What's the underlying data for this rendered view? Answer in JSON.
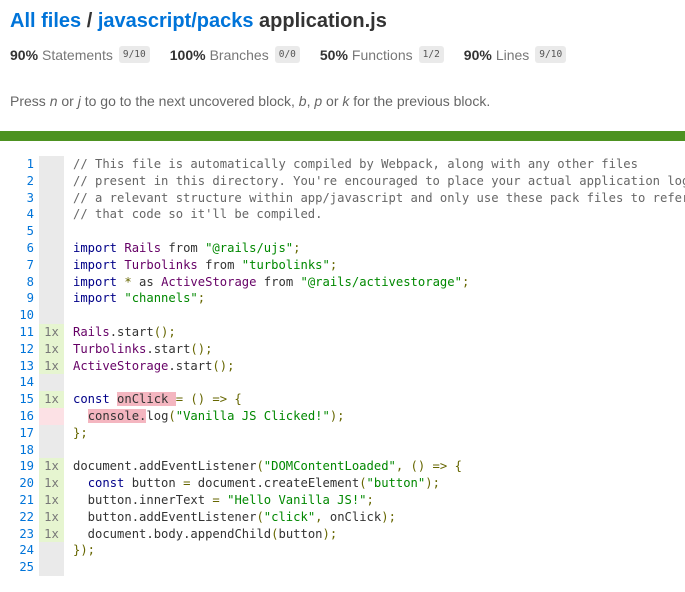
{
  "breadcrumb": {
    "all_files": "All files",
    "separator": " / ",
    "folder": "javascript/packs",
    "file": "application.js"
  },
  "stats": [
    {
      "pct": "90%",
      "label": "Statements",
      "frac": "9/10"
    },
    {
      "pct": "100%",
      "label": "Branches",
      "frac": "0/0"
    },
    {
      "pct": "50%",
      "label": "Functions",
      "frac": "1/2"
    },
    {
      "pct": "90%",
      "label": "Lines",
      "frac": "9/10"
    }
  ],
  "hint": {
    "t1": "Press ",
    "n": "n",
    "t2": " or ",
    "j": "j",
    "t3": " to go to the next uncovered block, ",
    "b": "b",
    "t4": ", ",
    "p": "p",
    "t5": " or ",
    "k": "k",
    "t6": " for the previous block."
  },
  "colors": {
    "status_bar": "#4d9221",
    "link": "#0074d9",
    "covered": "#e6f5d0",
    "uncovered": "#fce1e5",
    "uncovered_highlight": "#f4b6c0"
  },
  "lines": [
    {
      "n": "1",
      "hits": "",
      "cov": "neutral",
      "tokens": [
        {
          "t": "// This file is automatically compiled by Webpack, along with any other files",
          "c": "cm"
        }
      ]
    },
    {
      "n": "2",
      "hits": "",
      "cov": "neutral",
      "tokens": [
        {
          "t": "// present in this directory. You're encouraged to place your actual application logic in",
          "c": "cm"
        }
      ]
    },
    {
      "n": "3",
      "hits": "",
      "cov": "neutral",
      "tokens": [
        {
          "t": "// a relevant structure within app/javascript and only use these pack files to reference",
          "c": "cm"
        }
      ]
    },
    {
      "n": "4",
      "hits": "",
      "cov": "neutral",
      "tokens": [
        {
          "t": "// that code so it'll be compiled.",
          "c": "cm"
        }
      ]
    },
    {
      "n": "5",
      "hits": "",
      "cov": "neutral",
      "tokens": []
    },
    {
      "n": "6",
      "hits": "",
      "cov": "neutral",
      "tokens": [
        {
          "t": "import",
          "c": "kw"
        },
        {
          "t": " "
        },
        {
          "t": "Rails",
          "c": "tp"
        },
        {
          "t": " from "
        },
        {
          "t": "\"@rails/ujs\"",
          "c": "str"
        },
        {
          "t": ";",
          "c": "pn"
        }
      ]
    },
    {
      "n": "7",
      "hits": "",
      "cov": "neutral",
      "tokens": [
        {
          "t": "import",
          "c": "kw"
        },
        {
          "t": " "
        },
        {
          "t": "Turbolinks",
          "c": "tp"
        },
        {
          "t": " from "
        },
        {
          "t": "\"turbolinks\"",
          "c": "str"
        },
        {
          "t": ";",
          "c": "pn"
        }
      ]
    },
    {
      "n": "8",
      "hits": "",
      "cov": "neutral",
      "tokens": [
        {
          "t": "import",
          "c": "kw"
        },
        {
          "t": " "
        },
        {
          "t": "*",
          "c": "pn"
        },
        {
          "t": " as "
        },
        {
          "t": "ActiveStorage",
          "c": "tp"
        },
        {
          "t": " from "
        },
        {
          "t": "\"@rails/activestorage\"",
          "c": "str"
        },
        {
          "t": ";",
          "c": "pn"
        }
      ]
    },
    {
      "n": "9",
      "hits": "",
      "cov": "neutral",
      "tokens": [
        {
          "t": "import",
          "c": "kw"
        },
        {
          "t": " "
        },
        {
          "t": "\"channels\"",
          "c": "str"
        },
        {
          "t": ";",
          "c": "pn"
        }
      ]
    },
    {
      "n": "10",
      "hits": "",
      "cov": "neutral",
      "tokens": []
    },
    {
      "n": "11",
      "hits": "1x",
      "cov": "yes",
      "tokens": [
        {
          "t": "Rails",
          "c": "tp"
        },
        {
          "t": "."
        },
        {
          "t": "start"
        },
        {
          "t": "();",
          "c": "pn"
        }
      ]
    },
    {
      "n": "12",
      "hits": "1x",
      "cov": "yes",
      "tokens": [
        {
          "t": "Turbolinks",
          "c": "tp"
        },
        {
          "t": "."
        },
        {
          "t": "start"
        },
        {
          "t": "();",
          "c": "pn"
        }
      ]
    },
    {
      "n": "13",
      "hits": "1x",
      "cov": "yes",
      "tokens": [
        {
          "t": "ActiveStorage",
          "c": "tp"
        },
        {
          "t": "."
        },
        {
          "t": "start"
        },
        {
          "t": "();",
          "c": "pn"
        }
      ]
    },
    {
      "n": "14",
      "hits": "",
      "cov": "neutral",
      "tokens": []
    },
    {
      "n": "15",
      "hits": "1x",
      "cov": "yes",
      "tokens": [
        {
          "t": "const",
          "c": "kw"
        },
        {
          "t": " "
        },
        {
          "t": "onClick ",
          "c": "uncov"
        },
        {
          "t": "= () => {",
          "c": "pn"
        }
      ]
    },
    {
      "n": "16",
      "hits": "",
      "cov": "no",
      "tokens": [
        {
          "t": "  "
        },
        {
          "t": "console.",
          "c": "uncov"
        },
        {
          "t": "log"
        },
        {
          "t": "(",
          "c": "pn"
        },
        {
          "t": "\"Vanilla JS Clicked!\"",
          "c": "str"
        },
        {
          "t": ");",
          "c": "pn"
        }
      ]
    },
    {
      "n": "17",
      "hits": "",
      "cov": "neutral",
      "tokens": [
        {
          "t": "};",
          "c": "pn"
        }
      ]
    },
    {
      "n": "18",
      "hits": "",
      "cov": "neutral",
      "tokens": []
    },
    {
      "n": "19",
      "hits": "1x",
      "cov": "yes",
      "tokens": [
        {
          "t": "document"
        },
        {
          "t": "."
        },
        {
          "t": "addEventListener"
        },
        {
          "t": "(",
          "c": "pn"
        },
        {
          "t": "\"DOMContentLoaded\"",
          "c": "str"
        },
        {
          "t": ", () => {",
          "c": "pn"
        }
      ]
    },
    {
      "n": "20",
      "hits": "1x",
      "cov": "yes",
      "tokens": [
        {
          "t": "  "
        },
        {
          "t": "const",
          "c": "kw"
        },
        {
          "t": " button "
        },
        {
          "t": "=",
          "c": "pn"
        },
        {
          "t": " document."
        },
        {
          "t": "createElement"
        },
        {
          "t": "(",
          "c": "pn"
        },
        {
          "t": "\"button\"",
          "c": "str"
        },
        {
          "t": ");",
          "c": "pn"
        }
      ]
    },
    {
      "n": "21",
      "hits": "1x",
      "cov": "yes",
      "tokens": [
        {
          "t": "  button."
        },
        {
          "t": "innerText "
        },
        {
          "t": "=",
          "c": "pn"
        },
        {
          "t": " "
        },
        {
          "t": "\"Hello Vanilla JS!\"",
          "c": "str"
        },
        {
          "t": ";",
          "c": "pn"
        }
      ]
    },
    {
      "n": "22",
      "hits": "1x",
      "cov": "yes",
      "tokens": [
        {
          "t": "  button."
        },
        {
          "t": "addEventListener"
        },
        {
          "t": "(",
          "c": "pn"
        },
        {
          "t": "\"click\"",
          "c": "str"
        },
        {
          "t": ", ",
          "c": "pn"
        },
        {
          "t": "onClick"
        },
        {
          "t": ");",
          "c": "pn"
        }
      ]
    },
    {
      "n": "23",
      "hits": "1x",
      "cov": "yes",
      "tokens": [
        {
          "t": "  document."
        },
        {
          "t": "body"
        },
        {
          "t": "."
        },
        {
          "t": "appendChild"
        },
        {
          "t": "(",
          "c": "pn"
        },
        {
          "t": "button"
        },
        {
          "t": ");",
          "c": "pn"
        }
      ]
    },
    {
      "n": "24",
      "hits": "",
      "cov": "neutral",
      "tokens": [
        {
          "t": "});",
          "c": "pn"
        }
      ]
    },
    {
      "n": "25",
      "hits": "",
      "cov": "neutral",
      "tokens": []
    }
  ]
}
